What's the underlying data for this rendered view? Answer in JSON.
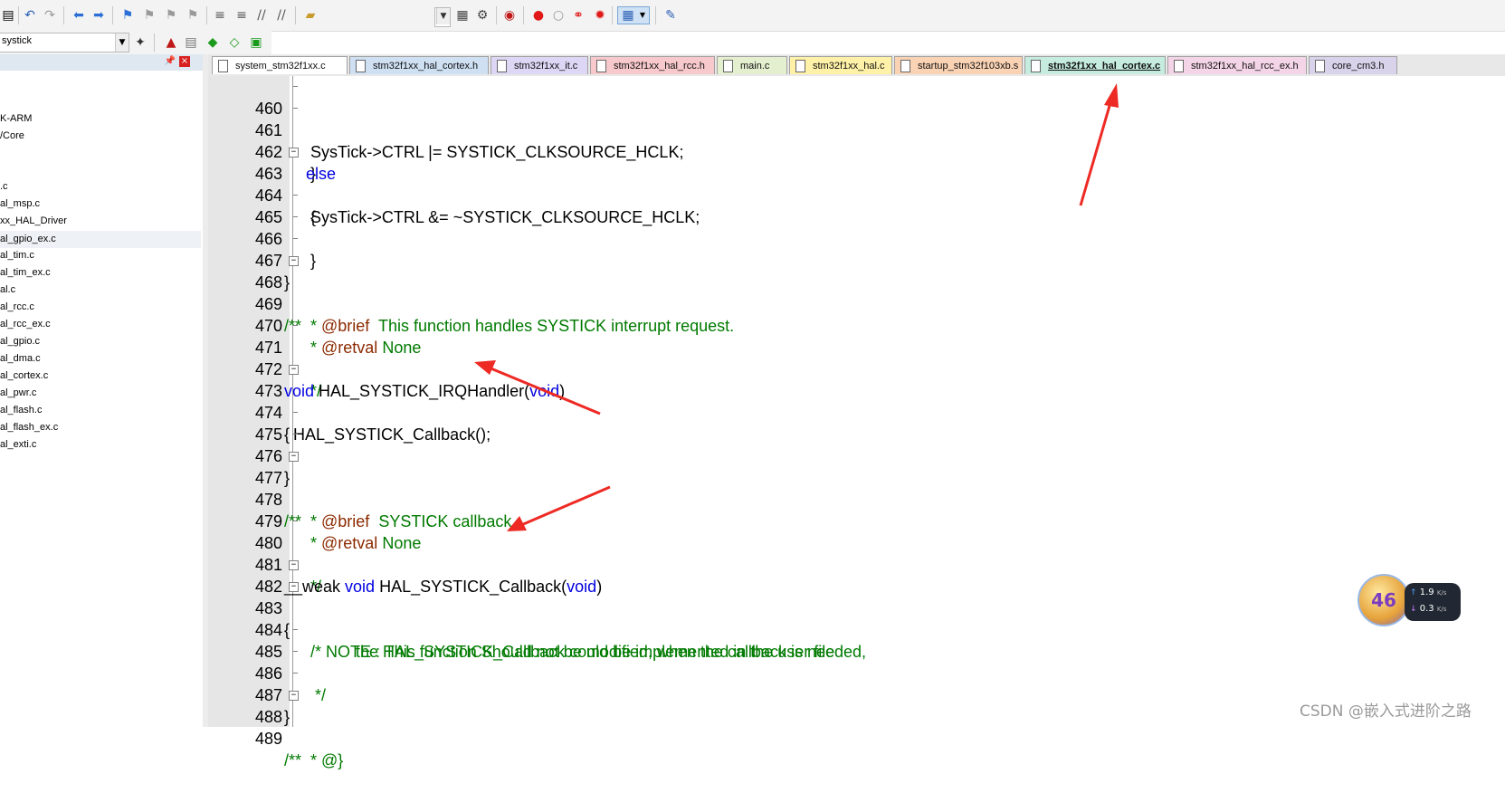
{
  "toolbar": {
    "icons": [
      "save-icon",
      "undo-icon",
      "redo-icon",
      "back-icon",
      "forward-icon",
      "bookmark-icon",
      "prev-bookmark-icon",
      "next-bookmark-icon",
      "clear-bookmarks-icon",
      "indent-icon",
      "unindent-icon",
      "comment-icon",
      "uncomment-icon",
      "find-in-files-icon",
      "incremental-find-icon",
      "debug-icon",
      "insert-breakpoint-icon",
      "enable-breakpoint-icon",
      "disable-breakpoints-icon",
      "kill-breakpoints-icon",
      "window-icon",
      "configure-icon"
    ]
  },
  "search": {
    "value": "systick"
  },
  "sidebar": {
    "items": [
      {
        "label": "K-ARM"
      },
      {
        "label": "/Core"
      },
      {
        "label": ".c"
      },
      {
        "label": "al_msp.c"
      },
      {
        "label": "xx_HAL_Driver"
      },
      {
        "label": "al_gpio_ex.c"
      },
      {
        "label": "al_tim.c"
      },
      {
        "label": "al_tim_ex.c"
      },
      {
        "label": "al.c"
      },
      {
        "label": "al_rcc.c"
      },
      {
        "label": "al_rcc_ex.c"
      },
      {
        "label": "al_gpio.c"
      },
      {
        "label": "al_dma.c"
      },
      {
        "label": "al_cortex.c"
      },
      {
        "label": "al_pwr.c"
      },
      {
        "label": "al_flash.c"
      },
      {
        "label": "al_flash_ex.c"
      },
      {
        "label": "al_exti.c"
      }
    ]
  },
  "tabs": [
    {
      "label": "system_stm32f1xx.c",
      "color": "#ffffff"
    },
    {
      "label": "stm32f1xx_hal_cortex.h",
      "color": "#cfe0f3"
    },
    {
      "label": "stm32f1xx_it.c",
      "color": "#ded6f5"
    },
    {
      "label": "stm32f1xx_hal_rcc.h",
      "color": "#f7c9cc"
    },
    {
      "label": "main.c",
      "color": "#e3efcf"
    },
    {
      "label": "stm32f1xx_hal.c",
      "color": "#fff1a8"
    },
    {
      "label": "startup_stm32f103xb.s",
      "color": "#fad3b5"
    },
    {
      "label": "stm32f1xx_hal_cortex.c",
      "color": "#c5ecdf"
    },
    {
      "label": "stm32f1xx_hal_rcc_ex.h",
      "color": "#f4d5e7"
    },
    {
      "label": "core_cm3.h",
      "color": "#d8d3ea"
    }
  ],
  "code": {
    "lines": [
      {
        "num": "460",
        "text": "    SysTick->CTRL |= SYSTICK_CLKSOURCE_HCLK;"
      },
      {
        "num": "461",
        "text": "  }"
      },
      {
        "num": "462",
        "text": "  else"
      },
      {
        "num": "463",
        "text": "  {"
      },
      {
        "num": "464",
        "text": "    SysTick->CTRL &= ~SYSTICK_CLKSOURCE_HCLK;"
      },
      {
        "num": "465",
        "text": "  }"
      },
      {
        "num": "466",
        "text": "}"
      },
      {
        "num": "467",
        "text": ""
      },
      {
        "num": "468",
        "text": "/**"
      },
      {
        "num": "469",
        "text": "  * @brief  This function handles SYSTICK interrupt request."
      },
      {
        "num": "470",
        "text": "  * @retval None"
      },
      {
        "num": "471",
        "text": "  */"
      },
      {
        "num": "472",
        "text": "void HAL_SYSTICK_IRQHandler(void)"
      },
      {
        "num": "473",
        "text": "{"
      },
      {
        "num": "474",
        "text": "  HAL_SYSTICK_Callback();"
      },
      {
        "num": "475",
        "text": "}"
      },
      {
        "num": "476",
        "text": ""
      },
      {
        "num": "477",
        "text": "/**"
      },
      {
        "num": "478",
        "text": "  * @brief  SYSTICK callback."
      },
      {
        "num": "479",
        "text": "  * @retval None"
      },
      {
        "num": "480",
        "text": "  */"
      },
      {
        "num": "481",
        "text": "__weak void HAL_SYSTICK_Callback(void)"
      },
      {
        "num": "482",
        "text": "{"
      },
      {
        "num": "483",
        "text": "  /* NOTE : This function Should not be modified, when the callback is needed,"
      },
      {
        "num": "484",
        "text": "            the HAL_SYSTICK_Callback could be implemented in the user file"
      },
      {
        "num": "485",
        "text": "   */"
      },
      {
        "num": "486",
        "text": "}"
      },
      {
        "num": "487",
        "text": ""
      },
      {
        "num": "488",
        "text": "/**"
      },
      {
        "num": "489",
        "text": "  * @}"
      }
    ]
  },
  "net_widget": {
    "badge": "46",
    "upload": "1.9",
    "download": "0.3",
    "unit": "K/s"
  },
  "watermark": "CSDN @嵌入式进阶之路",
  "colors": {
    "keyword": "#0000e0",
    "comment": "#007a00",
    "doc_tag": "#8b2a00",
    "annotation_arrow": "#ee2a24"
  }
}
